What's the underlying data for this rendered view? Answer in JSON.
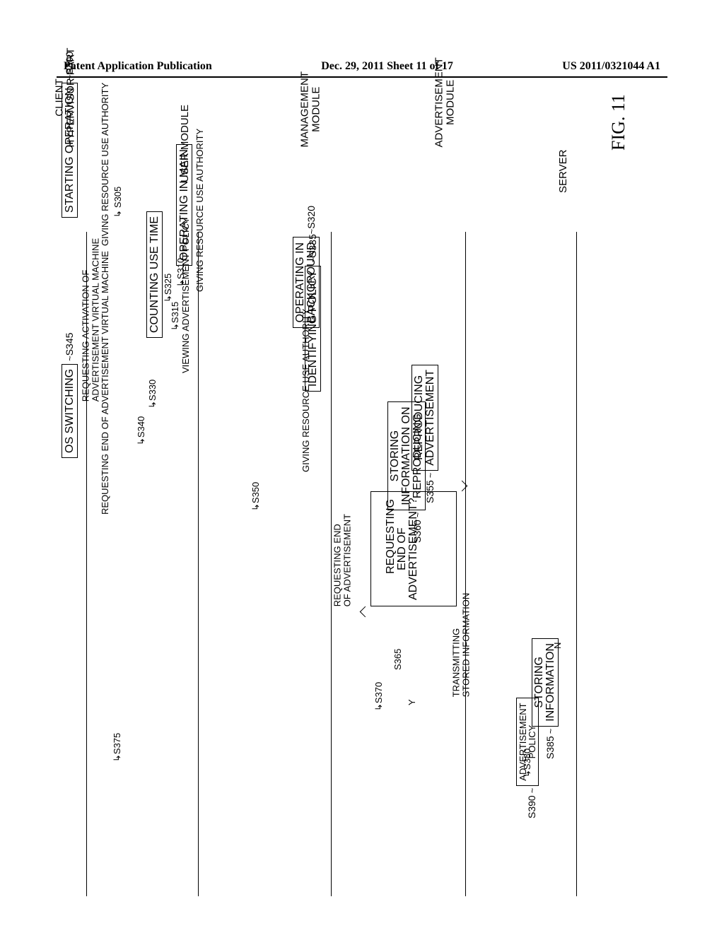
{
  "header": {
    "left": "Patent Application Publication",
    "center": "Dec. 29, 2011  Sheet 11 of 17",
    "right": "US 2011/0321044 A1"
  },
  "figure_label": "FIG. 11",
  "lanes": {
    "hypervisor": "CLIENT\nHYPERVISOR PART",
    "user": "USER MODULE",
    "management": "MANAGEMENT\nMODULE",
    "advertisement": "ADVERTISEMENT\nMODULE",
    "server": "SERVER"
  },
  "steps": {
    "s300": {
      "ref": "S300",
      "label": "STARTING OPERATION"
    },
    "s305": {
      "ref": "S305",
      "label": "GIVING RESOURCE USE AUTHORITY"
    },
    "s310": {
      "ref": "S310",
      "label": "OPERATING IN MAIN"
    },
    "s315": {
      "ref": "S315",
      "label": "GIVING RESOURCE USE AUTHORITY"
    },
    "s320": {
      "ref": "S320",
      "label": "OPERATING IN\nBACKGROUND"
    },
    "s325": {
      "ref": "S325",
      "label": "COUNTING USE TIME"
    },
    "s330": {
      "ref": "S330",
      "label": "VIEWING ADVERTISEMENT POLICY"
    },
    "s335": {
      "ref": "S335",
      "label": "IDENTIFYING POLICY"
    },
    "s340": {
      "ref": "S340",
      "label": "REQUESTING ACTIVATION OF\nADVERTISEMENT VIRTUAL MACHINE"
    },
    "s345": {
      "ref": "S345",
      "label": "OS SWITCHING"
    },
    "s350": {
      "ref": "S350",
      "label": "GIVING RESOURCE USE AUTHORITY"
    },
    "s355": {
      "ref": "S355",
      "label": "REPRODUCING\nADVERTISEMENT"
    },
    "s360": {
      "ref": "S360",
      "label": "STORING\nINFORMATION ON\nREPRODUCING"
    },
    "s365": {
      "ref": "S365",
      "label": "REQUESTING\nEND OF\nADVERTISEMENT?",
      "yes": "Y",
      "no": "N"
    },
    "s370": {
      "ref": "S370",
      "label": "REQUESTING END\nOF ADVERTISEMENT"
    },
    "s375": {
      "ref": "S375",
      "label": "REQUESTING END OF ADVERTISEMENT VIRTUAL MACHINE"
    },
    "s380": {
      "ref": "S380",
      "label": "TRANSMITTING\nSTORED INFORMATION"
    },
    "s385": {
      "ref": "S385",
      "label": "STORING\nINFORMATION"
    },
    "s390": {
      "ref": "S390",
      "label": "ADVERTISEMENT\nPOLICY"
    }
  },
  "chart_data": {
    "type": "table",
    "description": "UML-style sequence diagram (rotated 90° CCW on the page) showing message flow between Client Hypervisor Part, User Module, Management Module, Advertisement Module and Server.",
    "participants": [
      "CLIENT HYPERVISOR PART",
      "USER MODULE",
      "MANAGEMENT MODULE",
      "ADVERTISEMENT MODULE",
      "SERVER"
    ],
    "messages": [
      {
        "id": "S300",
        "at": "CLIENT HYPERVISOR PART",
        "label": "STARTING OPERATION",
        "kind": "action"
      },
      {
        "id": "S305",
        "from": "CLIENT HYPERVISOR PART",
        "to": "USER MODULE",
        "label": "GIVING RESOURCE USE AUTHORITY"
      },
      {
        "id": "S310",
        "at": "USER MODULE",
        "label": "OPERATING IN MAIN",
        "kind": "action"
      },
      {
        "id": "S315",
        "from": "CLIENT HYPERVISOR PART",
        "to": "MANAGEMENT MODULE",
        "label": "GIVING RESOURCE USE AUTHORITY"
      },
      {
        "id": "S320",
        "at": "MANAGEMENT MODULE",
        "label": "OPERATING IN BACKGROUND",
        "kind": "action"
      },
      {
        "id": "S325",
        "at": "USER MODULE",
        "label": "COUNTING USE TIME",
        "kind": "action"
      },
      {
        "id": "S330",
        "from": "USER MODULE",
        "to": "MANAGEMENT MODULE",
        "label": "VIEWING ADVERTISEMENT POLICY"
      },
      {
        "id": "S335",
        "at": "MANAGEMENT MODULE",
        "label": "IDENTIFYING POLICY",
        "kind": "action"
      },
      {
        "id": "S340",
        "from": "USER MODULE",
        "to": "CLIENT HYPERVISOR PART",
        "label": "REQUESTING ACTIVATION OF ADVERTISEMENT VIRTUAL MACHINE"
      },
      {
        "id": "S345",
        "at": "CLIENT HYPERVISOR PART",
        "label": "OS SWITCHING",
        "kind": "action"
      },
      {
        "id": "S350",
        "from": "CLIENT HYPERVISOR PART",
        "to": "ADVERTISEMENT MODULE",
        "label": "GIVING RESOURCE USE AUTHORITY"
      },
      {
        "id": "S355",
        "at": "ADVERTISEMENT MODULE",
        "label": "REPRODUCING ADVERTISEMENT",
        "kind": "action"
      },
      {
        "id": "S360",
        "at": "ADVERTISEMENT MODULE",
        "label": "STORING INFORMATION ON REPRODUCING",
        "kind": "action"
      },
      {
        "id": "S365",
        "at": "ADVERTISEMENT MODULE",
        "label": "REQUESTING END OF ADVERTISEMENT?",
        "kind": "decision",
        "yes_to": "S370",
        "no_to": "S355"
      },
      {
        "id": "S370",
        "from": "ADVERTISEMENT MODULE",
        "to": "MANAGEMENT MODULE",
        "label": "REQUESTING END OF ADVERTISEMENT"
      },
      {
        "id": "S375",
        "from": "MANAGEMENT MODULE",
        "to": "CLIENT HYPERVISOR PART",
        "label": "REQUESTING END OF ADVERTISEMENT VIRTUAL MACHINE"
      },
      {
        "id": "S380",
        "from": "ADVERTISEMENT MODULE",
        "to": "SERVER",
        "label": "TRANSMITTING STORED INFORMATION"
      },
      {
        "id": "S385",
        "at": "SERVER",
        "label": "STORING INFORMATION",
        "kind": "action"
      },
      {
        "id": "S390",
        "from": "SERVER",
        "to": "ADVERTISEMENT MODULE",
        "label": "ADVERTISEMENT POLICY"
      }
    ]
  }
}
